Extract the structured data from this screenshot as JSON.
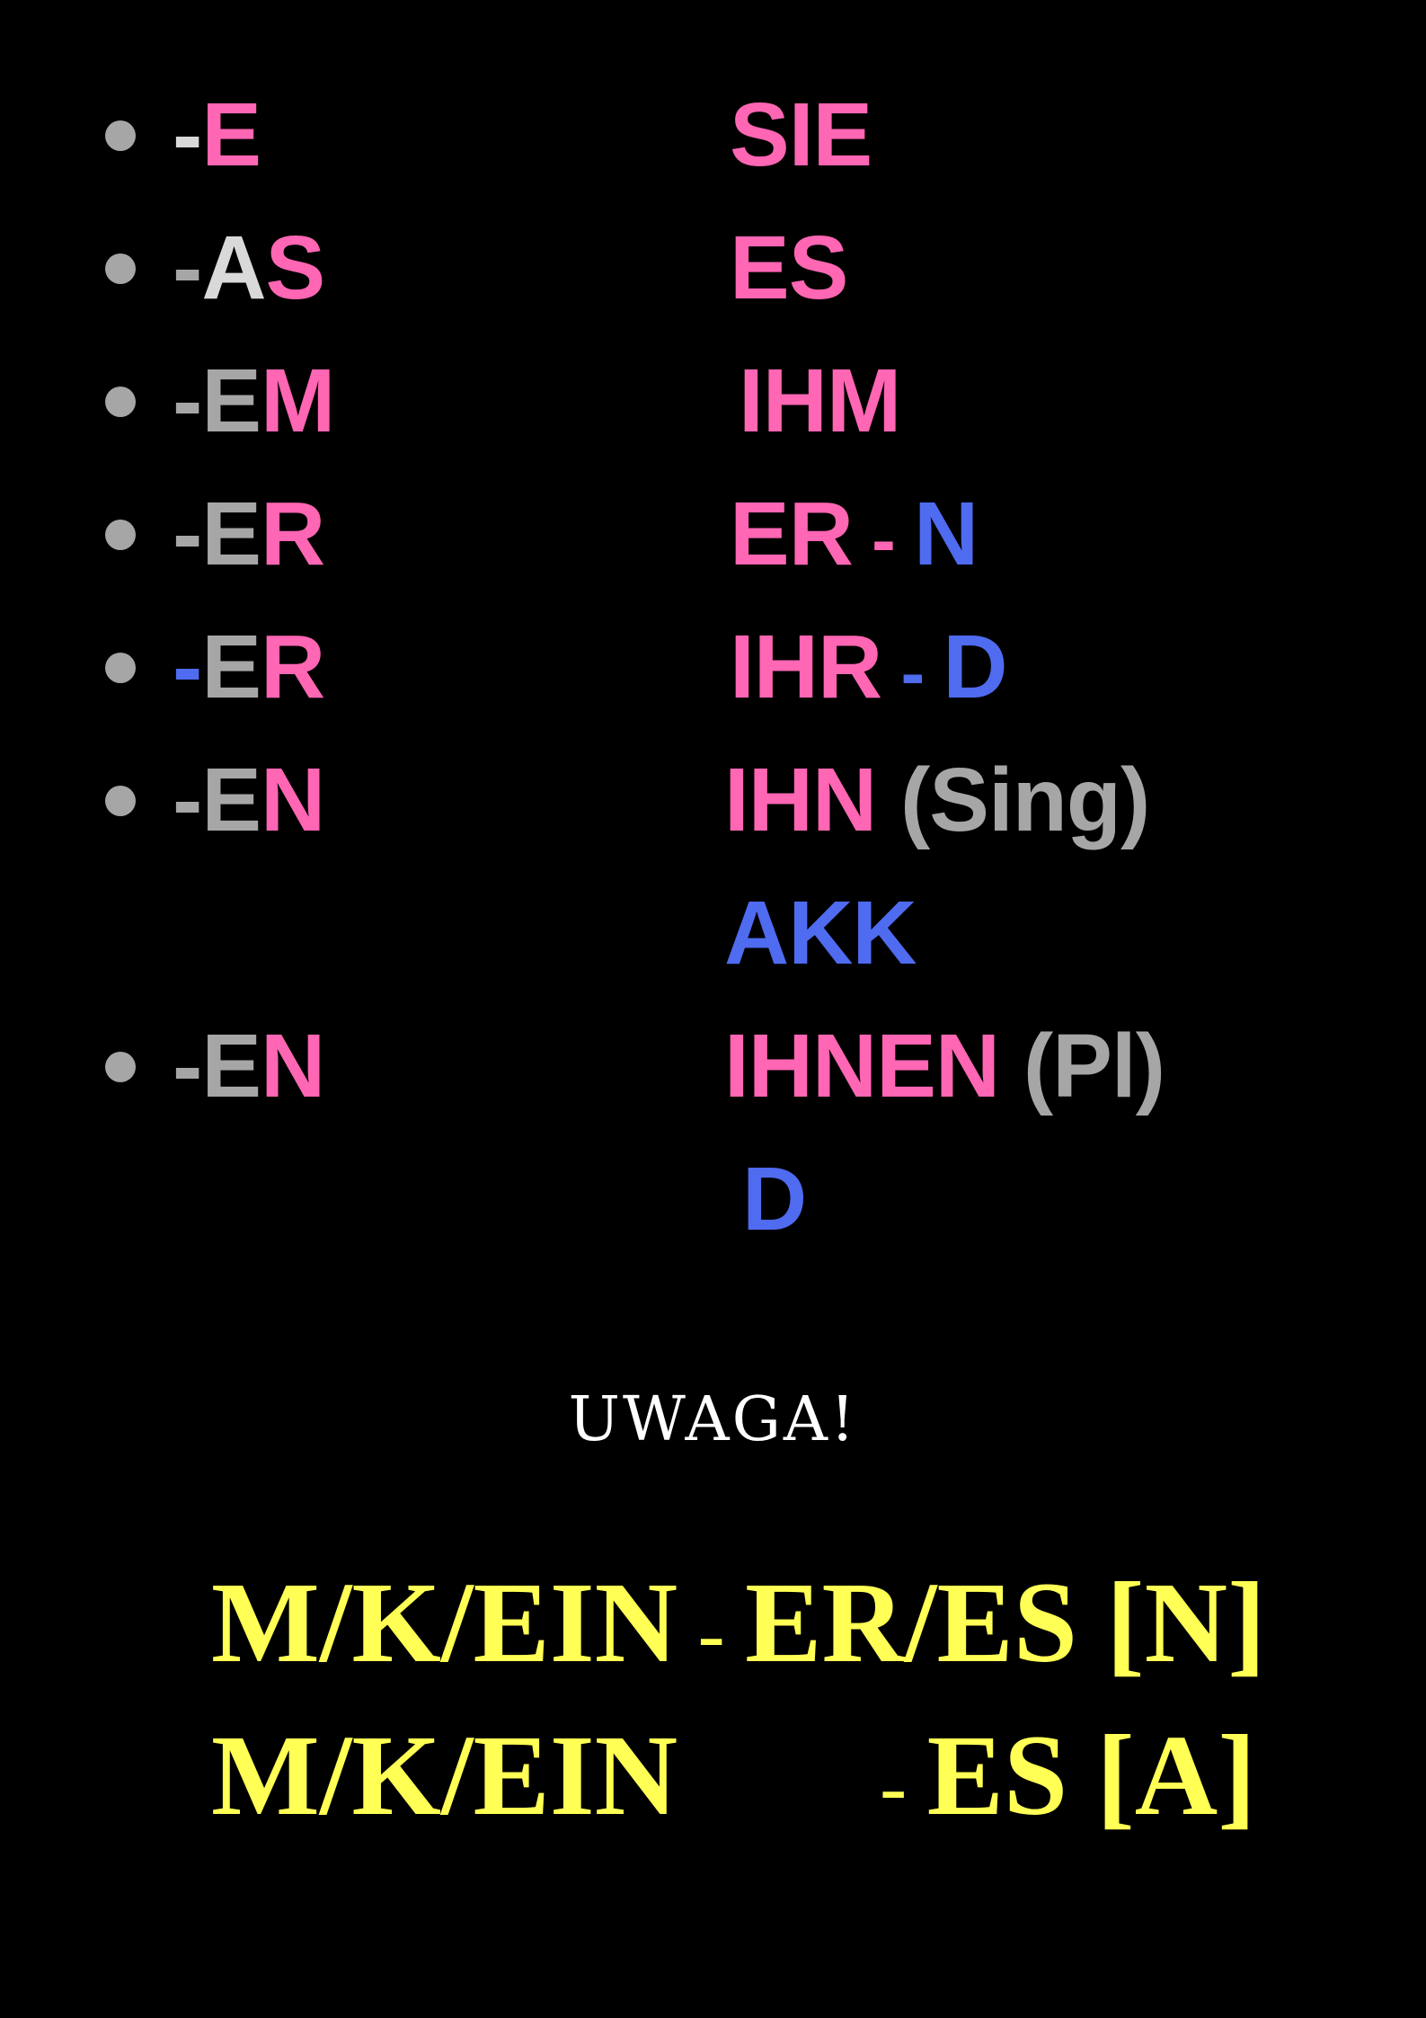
{
  "rows": [
    {
      "left": [
        {
          "t": "-",
          "c": "c-light"
        },
        {
          "t": "E",
          "c": "c-pink"
        }
      ],
      "right": [
        {
          "t": "SIE",
          "c": "c-pink"
        }
      ]
    },
    {
      "left": [
        {
          "t": "-",
          "c": "c-gray"
        },
        {
          "t": "A",
          "c": "c-light"
        },
        {
          "t": "S",
          "c": "c-pink"
        }
      ],
      "right": [
        {
          "t": "ES",
          "c": "c-pink"
        }
      ]
    },
    {
      "left": [
        {
          "t": "-",
          "c": "c-gray"
        },
        {
          "t": "E",
          "c": "c-gray"
        },
        {
          "t": "M",
          "c": "c-pink"
        }
      ],
      "right": [
        {
          "t": "IHM",
          "c": "c-pink"
        }
      ]
    },
    {
      "left": [
        {
          "t": "-",
          "c": "c-gray"
        },
        {
          "t": "E",
          "c": "c-gray"
        },
        {
          "t": "R",
          "c": "c-pink"
        }
      ],
      "right": [
        {
          "t": "ER",
          "c": "c-pink"
        },
        {
          "t": " - ",
          "c": "c-pink"
        },
        {
          "t": "N",
          "c": "c-blue"
        }
      ]
    },
    {
      "left": [
        {
          "t": "-",
          "c": "c-blue"
        },
        {
          "t": "E",
          "c": "c-gray"
        },
        {
          "t": "R",
          "c": "c-pink"
        }
      ],
      "right": [
        {
          "t": "IHR",
          "c": "c-pink"
        },
        {
          "t": " - ",
          "c": "c-blue"
        },
        {
          "t": "D",
          "c": "c-blue"
        }
      ]
    },
    {
      "left": [
        {
          "t": "-",
          "c": "c-gray"
        },
        {
          "t": "E",
          "c": "c-gray"
        },
        {
          "t": "N",
          "c": "c-pink"
        }
      ],
      "right": [
        {
          "t": "IHN",
          "c": "c-pink"
        },
        {
          "t": " (Sing)",
          "c": "c-gray"
        }
      ]
    },
    {
      "left": [],
      "right": [
        {
          "t": "AKK",
          "c": "c-blue"
        }
      ]
    },
    {
      "left": [
        {
          "t": "-",
          "c": "c-gray"
        },
        {
          "t": "E",
          "c": "c-gray"
        },
        {
          "t": "N",
          "c": "c-pink"
        }
      ],
      "right": [
        {
          "t": "IHNEN",
          "c": "c-pink"
        },
        {
          "t": " (Pl)",
          "c": "c-gray"
        }
      ]
    },
    {
      "left": [],
      "right": [
        {
          "t": "D",
          "c": "c-blue"
        }
      ]
    }
  ],
  "bullets": [
    true,
    true,
    true,
    true,
    true,
    true,
    false,
    true,
    false
  ],
  "uwaga": "UWAGA!",
  "formula1": {
    "a": "M/K/EIN",
    "dash": " - ",
    "b": "ER/ES [N]"
  },
  "formula2": {
    "a": "M/K/EIN",
    "dash": "- ",
    "b": "ES [A]"
  },
  "colors": {
    "gray": "#a6a6a6",
    "light": "#d9d9d9",
    "pink": "#ff66b3",
    "blue": "#4f6bf0",
    "yellow": "#ffff55",
    "background": "#000000"
  }
}
